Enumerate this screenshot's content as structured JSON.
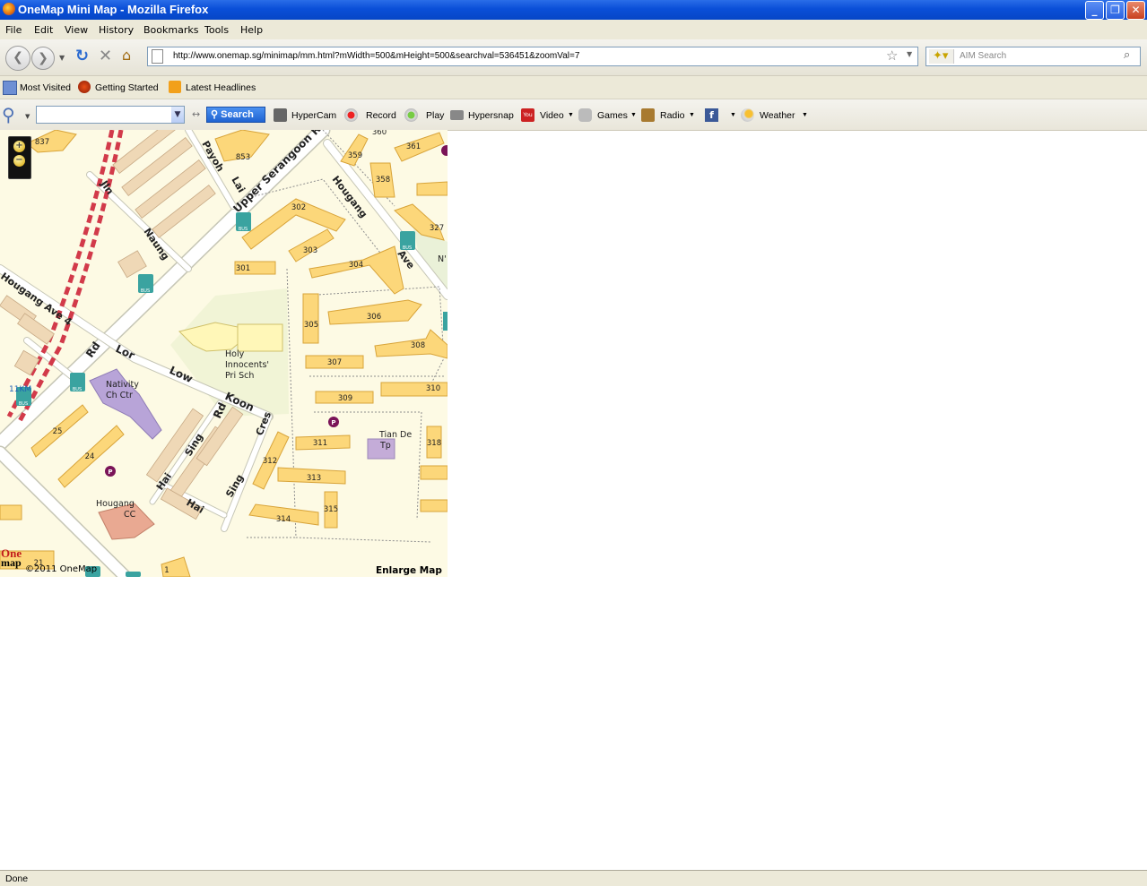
{
  "window": {
    "title": "OneMap Mini Map - Mozilla Firefox",
    "minimize": "_",
    "restore": "❐",
    "close": "✕"
  },
  "menu": [
    "File",
    "Edit",
    "View",
    "History",
    "Bookmarks",
    "Tools",
    "Help"
  ],
  "nav": {
    "url": "http://www.onemap.sg/minimap/mm.html?mWidth=500&mHeight=500&searchval=536451&zoomVal=7",
    "search_placeholder": "AIM Search"
  },
  "bookmarks": [
    "Most Visited",
    "Getting Started",
    "Latest Headlines"
  ],
  "toolbar": {
    "search_button": "Search",
    "items": [
      "HyperCam",
      "Record",
      "Play",
      "Hypersnap",
      "Video",
      "Games",
      "Radio",
      "Weather"
    ]
  },
  "map": {
    "copyright": "©2011 OneMap",
    "enlarge": "Enlarge Map",
    "logo_one": "One",
    "logo_map": "map",
    "zoom_in": "+",
    "zoom_out": "−",
    "roads": {
      "upper_serangoon": "Upper Serangoon R",
      "hougang_ave_top": "Hougang",
      "hougang_ave_top2": "Ave",
      "hougang_ave4": "Hougang Ave 4",
      "payoh": "Payoh",
      "lai": "Lai",
      "jln": "Jln",
      "naung": "Naung",
      "rd_left": "Rd",
      "lor": "Lor",
      "low": "Low",
      "koon": "Koon",
      "rd_koon": "Rd",
      "cres": "Cres",
      "sing1": "Sing",
      "sing2": "Sing",
      "hai1": "Hai",
      "hai2": "Hai"
    },
    "places": {
      "holy_1": "Holy",
      "holy_2": "Innocents'",
      "holy_3": "Pri Sch",
      "nativity_1": "Nativity",
      "nativity_2": "Ch Ctr",
      "tiande_1": "Tian De",
      "tiande_2": "Tp",
      "hougang_cc_1": "Hougang",
      "hougang_cc_2": "CC",
      "km": "11KM",
      "nv": "N'"
    },
    "blocks": [
      "837",
      "853",
      "302",
      "303",
      "304",
      "301",
      "305",
      "306",
      "307",
      "308",
      "309",
      "310",
      "311",
      "312",
      "313",
      "314",
      "315",
      "318",
      "359",
      "358",
      "361",
      "360",
      "327",
      "25",
      "24",
      "21",
      "1"
    ],
    "parking": "P",
    "bus": "BUS"
  },
  "status": "Done"
}
